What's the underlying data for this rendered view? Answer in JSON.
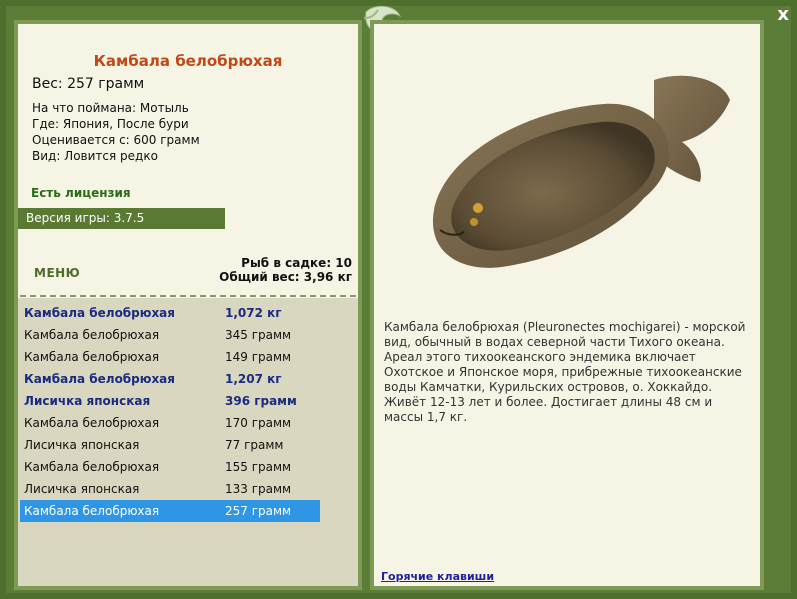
{
  "window": {
    "close_label": "x"
  },
  "fish": {
    "title": "Камбала белобрюхая",
    "weight": "Вес: 257 грамм",
    "caught_on": "На что поймана: Мотыль",
    "location": "Где: Япония, После бури",
    "value": "Оценивается с: 600 грамм",
    "rarity": "Вид: Ловится редко"
  },
  "license": "Есть лицензия",
  "version": "Версия игры: 3.7.5",
  "menu_label": "МЕНЮ",
  "stats": {
    "fish_count": "Рыб в садке: 10",
    "total_weight": "Общий вес: 3,96 кг"
  },
  "catch_list": [
    {
      "name": "Камбала белобрюхая",
      "weight": "1,072 кг",
      "bold": true
    },
    {
      "name": "Камбала белобрюхая",
      "weight": "345 грамм",
      "bold": false
    },
    {
      "name": "Камбала белобрюхая",
      "weight": "149 грамм",
      "bold": false
    },
    {
      "name": "Камбала белобрюхая",
      "weight": "1,207 кг",
      "bold": true
    },
    {
      "name": "Лисичка японская",
      "weight": "396 грамм",
      "bold": true
    },
    {
      "name": "Камбала белобрюхая",
      "weight": "170 грамм",
      "bold": false
    },
    {
      "name": "Лисичка японская",
      "weight": "77 грамм",
      "bold": false
    },
    {
      "name": "Камбала белобрюхая",
      "weight": "155 грамм",
      "bold": false
    },
    {
      "name": "Лисичка японская",
      "weight": "133 грамм",
      "bold": false
    },
    {
      "name": "Камбала белобрюхая",
      "weight": "257 грамм",
      "bold": false,
      "selected": true
    }
  ],
  "description": "Камбала белобрюхая (Pleuronectes mochigarei) - морской вид, обычный в водах северной части Тихого океана. Ареал этого тихоокеанского эндемика включает Охотское и Японское моря, прибрежные тихоокеанские воды Камчатки, Курильских островов, о. Хоккайдо. Живёт 12-13 лет и более. Достигает длины 48 см и массы 1,7 кг.",
  "hotkeys_label": "Горячие клавиши"
}
